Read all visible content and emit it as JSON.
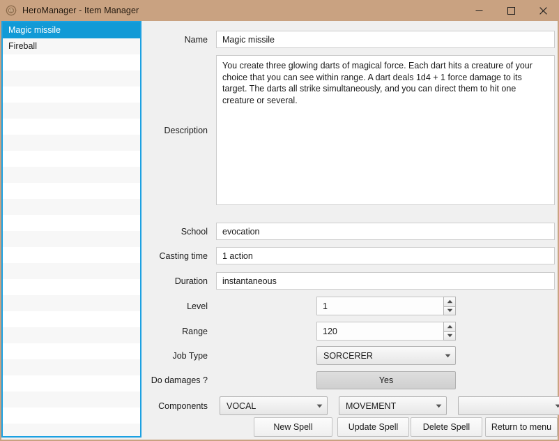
{
  "window": {
    "title": "HeroManager - Item Manager",
    "icon": "app-gear-icon",
    "titlebar_color": "#c9a281",
    "accent_color": "#119ad6",
    "controls": {
      "minimize": "minimize-icon",
      "maximize": "maximize-icon",
      "close": "close-icon"
    }
  },
  "spell_list": {
    "items": [
      {
        "label": "Magic missile",
        "selected": true
      },
      {
        "label": "Fireball",
        "selected": false
      }
    ],
    "empty_row_count": 23
  },
  "form": {
    "name": {
      "label": "Name",
      "value": "Magic missile",
      "placeholder": ""
    },
    "description": {
      "label": "Description",
      "value": "You create three glowing darts of magical force. Each dart hits a creature of your choice that you can see within range. A dart deals 1d4 + 1 force damage to its target. The darts all strike simultaneously, and you can direct them to hit one creature or several.",
      "placeholder": ""
    },
    "school": {
      "label": "School",
      "value": "evocation",
      "placeholder": ""
    },
    "casting_time": {
      "label": "Casting time",
      "value": "1 action",
      "placeholder": ""
    },
    "duration": {
      "label": "Duration",
      "value": "instantaneous",
      "placeholder": ""
    },
    "level": {
      "label": "Level",
      "value": "1"
    },
    "range": {
      "label": "Range",
      "value": "120"
    },
    "job_type": {
      "label": "Job Type",
      "value": "SORCERER"
    },
    "do_damages": {
      "label": "Do damages ?",
      "value": "Yes"
    },
    "components": {
      "label": "Components",
      "slots": [
        {
          "value": "VOCAL"
        },
        {
          "value": "MOVEMENT"
        },
        {
          "value": ""
        }
      ]
    }
  },
  "actions": {
    "new_spell": "New Spell",
    "update_spell": "Update Spell",
    "delete_spell": "Delete Spell",
    "return_to_menu": "Return to menu"
  }
}
